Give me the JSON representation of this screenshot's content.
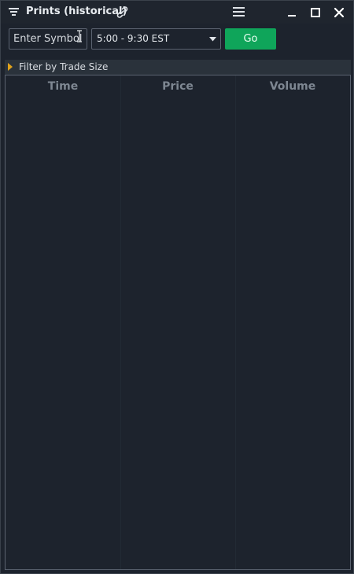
{
  "window": {
    "title": "Prints (historical)"
  },
  "toolbar": {
    "symbol_placeholder": "Enter Symbol",
    "time_range_value": "5:00 - 9:30 EST",
    "go_label": "Go"
  },
  "filter": {
    "label": "Filter by Trade Size"
  },
  "table": {
    "columns": [
      "Time",
      "Price",
      "Volume"
    ],
    "rows": []
  },
  "colors": {
    "background": "#1d232d",
    "accent_go": "#0fa55a",
    "filter_arrow": "#e0a21b"
  }
}
